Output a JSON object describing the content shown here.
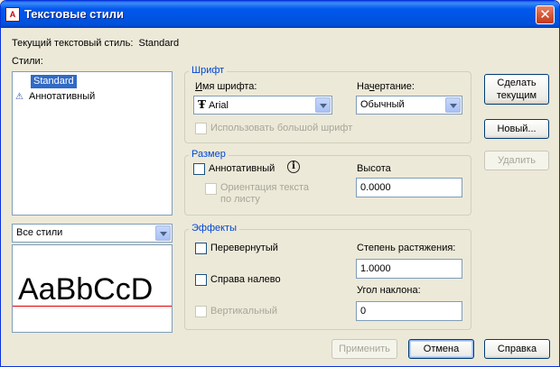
{
  "window": {
    "title": "Текстовые стили",
    "app_icon_text": "A"
  },
  "current_style": {
    "label": "Текущий текстовый стиль:",
    "value": "Standard"
  },
  "styles": {
    "label": "Стили:",
    "items": [
      {
        "name": "Standard",
        "selected": true,
        "icon": ""
      },
      {
        "name": "Аннотативный",
        "selected": false,
        "icon": "annotative-icon"
      }
    ],
    "filter_value": "Все стили"
  },
  "preview": {
    "sample_text": "AaBbCcD"
  },
  "font_group": {
    "title": "Шрифт",
    "font_name_label": "Имя шрифта:",
    "font_name_value": "Arial",
    "font_style_label": "Начертание:",
    "font_style_value": "Обычный",
    "big_font_label": "Использовать большой шрифт"
  },
  "size_group": {
    "title": "Размер",
    "annotative_label": "Аннотативный",
    "orientation_label_1": "Ориентация текста",
    "orientation_label_2": "по листу",
    "height_label": "Высота",
    "height_value": "0.0000"
  },
  "effects_group": {
    "title": "Эффекты",
    "upside_down_label": "Перевернутый",
    "backwards_label": "Справа налево",
    "vertical_label": "Вертикальный",
    "width_factor_label": "Степень растяжения:",
    "width_factor_value": "1.0000",
    "oblique_label": "Угол наклона:",
    "oblique_value": "0"
  },
  "buttons": {
    "set_current": [
      "Сделать",
      "текущим"
    ],
    "new": "Новый...",
    "delete": "Удалить",
    "apply": "Применить",
    "cancel": "Отмена",
    "help": "Справка"
  },
  "colors": {
    "titlebar": "#0054e3",
    "group_title": "#0046d5",
    "selection": "#316ac5",
    "baseline": "#e00000"
  }
}
